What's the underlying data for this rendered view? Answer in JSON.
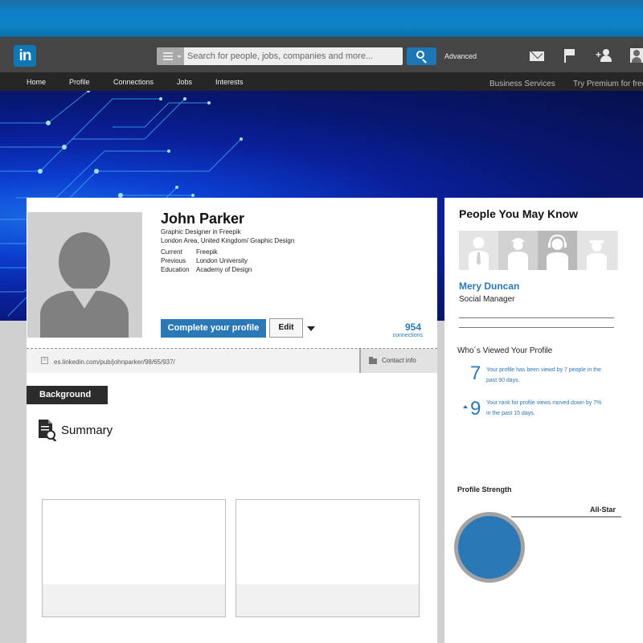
{
  "header": {
    "logo": "in",
    "search_placeholder": "Search for people, jobs, companies and more...",
    "advanced_label": "Advanced"
  },
  "nav": {
    "items": [
      "Home",
      "Profile",
      "Connections",
      "Jobs",
      "Interests"
    ],
    "right": [
      "Business Services",
      "Try Premium for free"
    ]
  },
  "profile": {
    "name": "John Parker",
    "headline": "Graphic Designer in Freepik",
    "location": "London Area, United Kingdom/ Graphic Design",
    "details": [
      {
        "key": "Current",
        "value": "Freepik"
      },
      {
        "key": "Previous",
        "value": "London University"
      },
      {
        "key": "Education",
        "value": "Academy of Design"
      }
    ],
    "complete_button": "Complete your profile",
    "edit_button": "Edit",
    "connections_count": "954",
    "connections_label": "connections",
    "url": "es.linkedin.com/pub/johnparker/98/65/937/",
    "contact_info": "Contact info"
  },
  "background": {
    "tab_label": "Background",
    "summary_title": "Summary"
  },
  "sidebar": {
    "pymk_title": "People You May Know",
    "suggestion_name": "Mery Duncan",
    "suggestion_role": "Social Manager",
    "wvp_title": "Who´s Viewed Your Profile",
    "stats": [
      {
        "number": "7",
        "text": "Your profile has been viewd by 7 people in the past 90 days."
      },
      {
        "number": "9",
        "text": "Your rank for profile views moved down by 7% in the past 15 days."
      }
    ],
    "strength_title": "Profile Strength",
    "strength_level": "All-Star"
  },
  "colors": {
    "linkedin_blue": "#2b78b7",
    "header_gray": "#454545",
    "nav_dark": "#262626"
  }
}
